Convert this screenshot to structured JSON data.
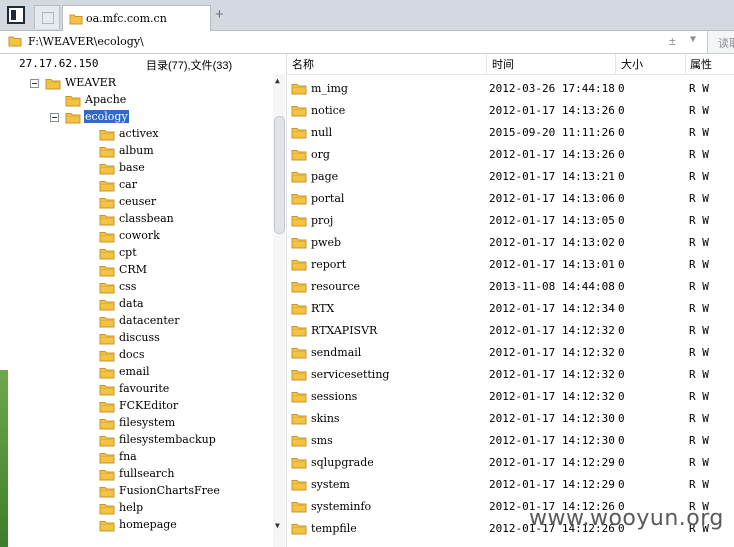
{
  "browser": {
    "tab_title": "oa.mfc.com.cn",
    "new_tab": "+",
    "address": "F:\\WEAVER\\ecology\\",
    "addr_plusminus": "± ",
    "addr_dropdown": "▼",
    "read_button": "读取"
  },
  "left": {
    "ip": "27.17.62.150",
    "summary": "目录(77),文件(33)",
    "tree": [
      {
        "label": "WEAVER",
        "level": 0,
        "expanded": true
      },
      {
        "label": "Apache",
        "level": 1
      },
      {
        "label": "ecology",
        "level": 1,
        "expanded": true,
        "selected": true
      },
      {
        "label": "activex",
        "level": 2
      },
      {
        "label": "album",
        "level": 2
      },
      {
        "label": "base",
        "level": 2
      },
      {
        "label": "car",
        "level": 2
      },
      {
        "label": "ceuser",
        "level": 2
      },
      {
        "label": "classbean",
        "level": 2
      },
      {
        "label": "cowork",
        "level": 2
      },
      {
        "label": "cpt",
        "level": 2
      },
      {
        "label": "CRM",
        "level": 2
      },
      {
        "label": "css",
        "level": 2
      },
      {
        "label": "data",
        "level": 2
      },
      {
        "label": "datacenter",
        "level": 2
      },
      {
        "label": "discuss",
        "level": 2
      },
      {
        "label": "docs",
        "level": 2
      },
      {
        "label": "email",
        "level": 2
      },
      {
        "label": "favourite",
        "level": 2
      },
      {
        "label": "FCKEditor",
        "level": 2
      },
      {
        "label": "filesystem",
        "level": 2
      },
      {
        "label": "filesystembackup",
        "level": 2
      },
      {
        "label": "fna",
        "level": 2
      },
      {
        "label": "fullsearch",
        "level": 2
      },
      {
        "label": "FusionChartsFree",
        "level": 2
      },
      {
        "label": "help",
        "level": 2
      },
      {
        "label": "homepage",
        "level": 2
      }
    ],
    "scroll_up": "▲",
    "scroll_down": "▼"
  },
  "right": {
    "columns": [
      "名称",
      "时间",
      "大小",
      "属性"
    ],
    "rows": [
      {
        "name": "m_img",
        "time": "2012-03-26 17:44:18",
        "size": "0",
        "attr": "R W"
      },
      {
        "name": "notice",
        "time": "2012-01-17 14:13:26",
        "size": "0",
        "attr": "R W"
      },
      {
        "name": "null",
        "time": "2015-09-20 11:11:26",
        "size": "0",
        "attr": "R W"
      },
      {
        "name": "org",
        "time": "2012-01-17 14:13:26",
        "size": "0",
        "attr": "R W"
      },
      {
        "name": "page",
        "time": "2012-01-17 14:13:21",
        "size": "0",
        "attr": "R W"
      },
      {
        "name": "portal",
        "time": "2012-01-17 14:13:06",
        "size": "0",
        "attr": "R W"
      },
      {
        "name": "proj",
        "time": "2012-01-17 14:13:05",
        "size": "0",
        "attr": "R W"
      },
      {
        "name": "pweb",
        "time": "2012-01-17 14:13:02",
        "size": "0",
        "attr": "R W"
      },
      {
        "name": "report",
        "time": "2012-01-17 14:13:01",
        "size": "0",
        "attr": "R W"
      },
      {
        "name": "resource",
        "time": "2013-11-08 14:44:08",
        "size": "0",
        "attr": "R W"
      },
      {
        "name": "RTX",
        "time": "2012-01-17 14:12:34",
        "size": "0",
        "attr": "R W"
      },
      {
        "name": "RTXAPISVR",
        "time": "2012-01-17 14:12:32",
        "size": "0",
        "attr": "R W"
      },
      {
        "name": "sendmail",
        "time": "2012-01-17 14:12:32",
        "size": "0",
        "attr": "R W"
      },
      {
        "name": "servicesetting",
        "time": "2012-01-17 14:12:32",
        "size": "0",
        "attr": "R W"
      },
      {
        "name": "sessions",
        "time": "2012-01-17 14:12:32",
        "size": "0",
        "attr": "R W"
      },
      {
        "name": "skins",
        "time": "2012-01-17 14:12:30",
        "size": "0",
        "attr": "R W"
      },
      {
        "name": "sms",
        "time": "2012-01-17 14:12:30",
        "size": "0",
        "attr": "R W"
      },
      {
        "name": "sqlupgrade",
        "time": "2012-01-17 14:12:29",
        "size": "0",
        "attr": "R W"
      },
      {
        "name": "system",
        "time": "2012-01-17 14:12:29",
        "size": "0",
        "attr": "R W"
      },
      {
        "name": "systeminfo",
        "time": "2012-01-17 14:12:26",
        "size": "0",
        "attr": "R W"
      },
      {
        "name": "tempfile",
        "time": "2012-01-17 14:12:26",
        "size": "0",
        "attr": "R W"
      }
    ]
  },
  "watermark": "www.wooyun.org",
  "colors": {
    "folder": "#f3c443",
    "folder_edge": "#c9952a",
    "selection": "#3169c6"
  }
}
